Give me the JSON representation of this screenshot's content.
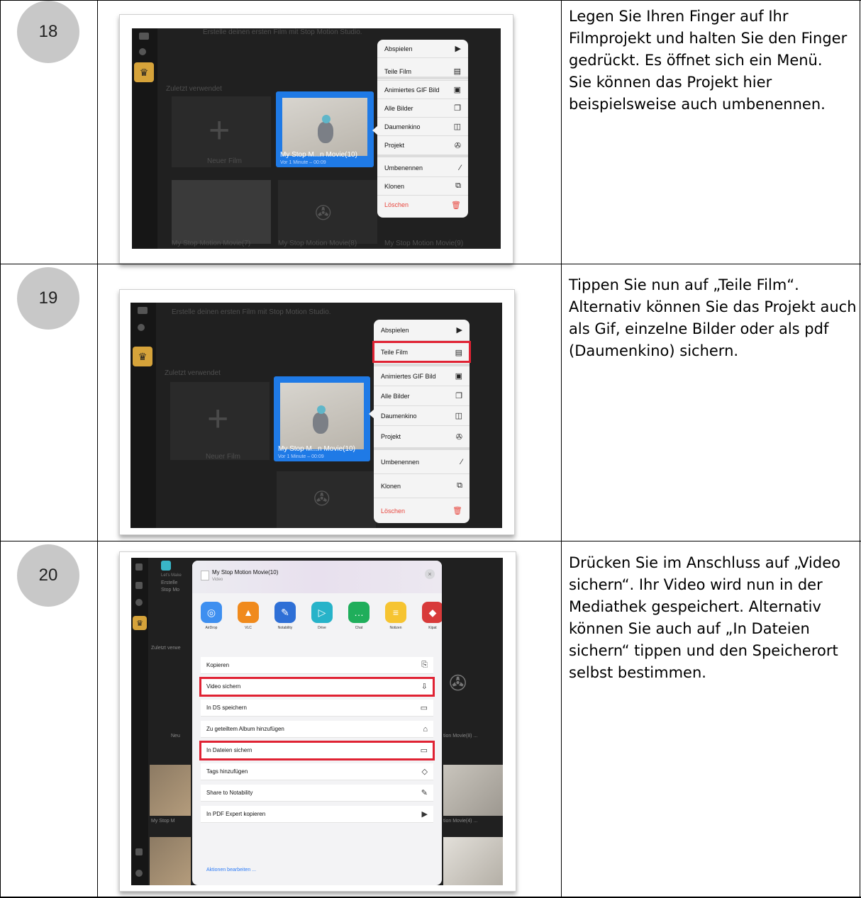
{
  "rows": [
    {
      "step": "18",
      "description": [
        "Legen Sie Ihren Finger auf Ihr Filmprojekt und halten Sie den Finger gedrückt. Es öffnet sich ein Menü.",
        "Sie können das Projekt hier beispielsweise auch umbenennen."
      ],
      "bg_texts": [
        "Erstelle deinen ersten Film mit Stop Motion Studio.",
        "Zuletzt verwendet",
        "Neuer Film",
        "My Stop Motion Movie(7)",
        "My Stop Motion Movie(8)",
        "My Stop Motion Movie(9)"
      ],
      "card_title": "My Stop M...n Movie(10)",
      "card_sub": "Vor 1 Minute – 00:09",
      "menu": [
        {
          "label": "Abspielen",
          "icon": "▶"
        },
        {
          "label": "Teile Film",
          "icon": "▤"
        },
        {
          "label": "Animiertes GIF Bild",
          "icon": "▣"
        },
        {
          "label": "Alle Bilder",
          "icon": "❐"
        },
        {
          "label": "Daumenkino",
          "icon": "◫"
        },
        {
          "label": "Projekt",
          "icon": "✇"
        },
        {
          "label": "Umbenennen",
          "icon": "⁄"
        },
        {
          "label": "Klonen",
          "icon": "⧉"
        },
        {
          "label": "Löschen",
          "icon": "🗑"
        }
      ]
    },
    {
      "step": "19",
      "description": [
        "Tippen Sie nun auf „Teile Film“. Alternativ können Sie das Projekt auch als Gif, einzelne Bilder oder als pdf (Daumenkino) sichern."
      ],
      "bg_texts": [
        "Erstelle deinen ersten Film mit Stop Motion Studio.",
        "Zuletzt verwendet",
        "Neuer Film"
      ],
      "card_title": "My Stop M...n Movie(10)",
      "card_sub": "Vor 1 Minute – 00:09",
      "highlighted": "Teile Film"
    },
    {
      "step": "20",
      "description": [
        "Drücken Sie im Anschluss auf „Video sichern“. Ihr Video wird nun in der Mediathek gespeichert. Alternativ können Sie auch auf „In Dateien sichern“ tippen und den Speicherort selbst bestimmen."
      ],
      "bg_texts": [
        "Let's Make",
        "Erstelle",
        "Stop Mo",
        "Zuletzt verwe",
        "Neu",
        "My Stop M",
        "tion Movie(8) ...",
        "tion Movie(4) ..."
      ],
      "share_title": "My Stop Motion Movie(10)",
      "share_sub": "Video",
      "apps": [
        {
          "label": "AirDrop",
          "color": "#3e8ff0",
          "icon": "◎"
        },
        {
          "label": "VLC",
          "color": "#f08a1c",
          "icon": "▲"
        },
        {
          "label": "Notability",
          "color": "#2e6fd6",
          "icon": "✎"
        },
        {
          "label": "Drive",
          "color": "#27b3c9",
          "icon": "▷"
        },
        {
          "label": "Chat",
          "color": "#1fae5b",
          "icon": "…"
        },
        {
          "label": "Notizen",
          "color": "#f6c431",
          "icon": "≡"
        },
        {
          "label": "Kipat",
          "color": "#d83a3a",
          "icon": "◆"
        }
      ],
      "actions": [
        {
          "label": "Kopieren",
          "icon": "⎘"
        },
        {
          "label": "Video sichern",
          "icon": "⇩"
        },
        {
          "label": "In DS speichern",
          "icon": "▭"
        },
        {
          "label": "Zu geteiltem Album hinzufügen",
          "icon": "⌂"
        },
        {
          "label": "In Dateien sichern",
          "icon": "▭"
        },
        {
          "label": "Tags hinzufügen",
          "icon": "◇"
        },
        {
          "label": "Share to Notability",
          "icon": "✎"
        },
        {
          "label": "In PDF Expert kopieren",
          "icon": "▶"
        }
      ],
      "edit_actions": "Aktionen bearbeiten ...",
      "highlighted": [
        "Video sichern",
        "In Dateien sichern"
      ]
    }
  ]
}
